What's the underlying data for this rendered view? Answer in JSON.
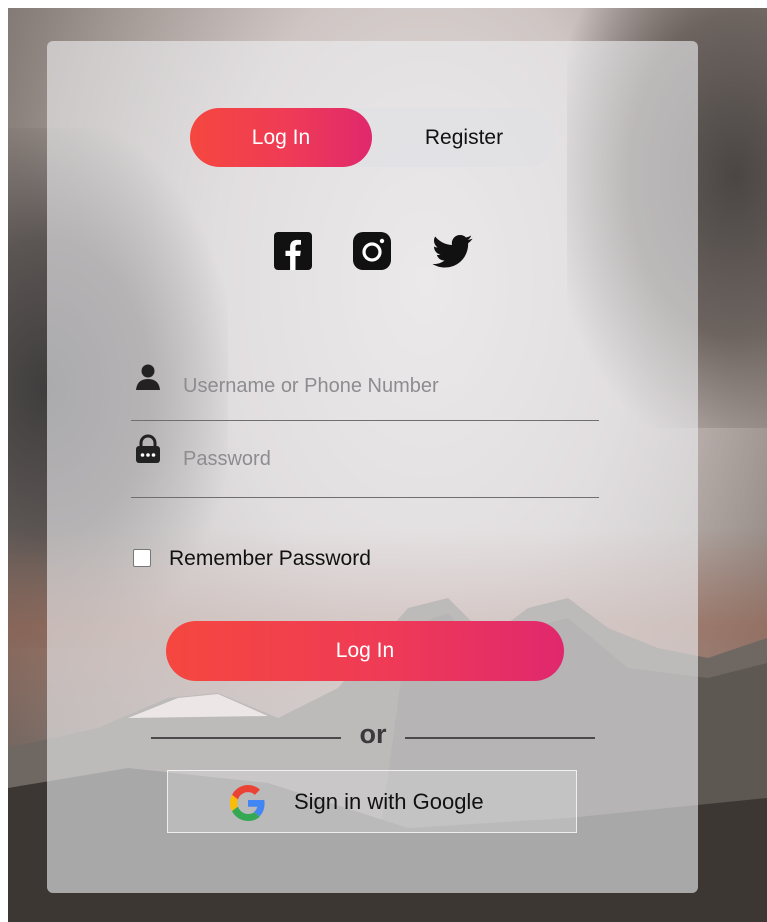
{
  "tabs": {
    "login": "Log In",
    "register": "Register"
  },
  "social": [
    "facebook-icon",
    "instagram-icon",
    "twitter-icon"
  ],
  "username": {
    "placeholder": "Username or Phone Number",
    "value": ""
  },
  "password": {
    "placeholder": "Password",
    "value": ""
  },
  "remember": {
    "label": "Remember Password",
    "checked": false
  },
  "login_button": "Log In",
  "divider_text": "or",
  "google_button": "Sign in with Google",
  "colors": {
    "gradient_start": "#f5473f",
    "gradient_end": "#e0286d"
  }
}
